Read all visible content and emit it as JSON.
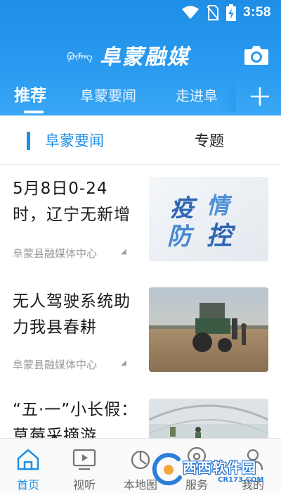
{
  "status_bar": {
    "time": "3:58"
  },
  "header": {
    "brand_mongolian": "ᠹᠦᠮᠡᠩ",
    "brand_title": "阜蒙融媒",
    "tabs": [
      {
        "label": "推荐",
        "active": true
      },
      {
        "label": "阜蒙要闻",
        "active": false
      },
      {
        "label": "走进阜",
        "active": false
      }
    ]
  },
  "subtabs": {
    "news_label": "阜蒙要闻",
    "topic_label": "专题"
  },
  "news": [
    {
      "title": "5月8日0-24时，辽宁无新增",
      "source": "阜蒙县融媒体中心",
      "thumb_text": [
        "疫",
        "情",
        "防",
        "控"
      ]
    },
    {
      "title": "无人驾驶系统助力我县春耕",
      "source": "阜蒙县融媒体中心"
    },
    {
      "title": "“五·一”小长假：草莓采摘游"
    }
  ],
  "bottom_nav": [
    {
      "label": "首页",
      "icon": "home-icon",
      "active": true
    },
    {
      "label": "视听",
      "icon": "tv-icon",
      "active": false
    },
    {
      "label": "本地图",
      "icon": "map-icon",
      "active": false
    },
    {
      "label": "服务",
      "icon": "location-icon",
      "active": false
    },
    {
      "label": "我的",
      "icon": "user-icon",
      "active": false
    }
  ],
  "watermark": {
    "text": "西西软件园",
    "domain": "CR173.COM"
  },
  "colors": {
    "header_blue": "#2a9bf0",
    "accent": "#1d8fe7"
  }
}
